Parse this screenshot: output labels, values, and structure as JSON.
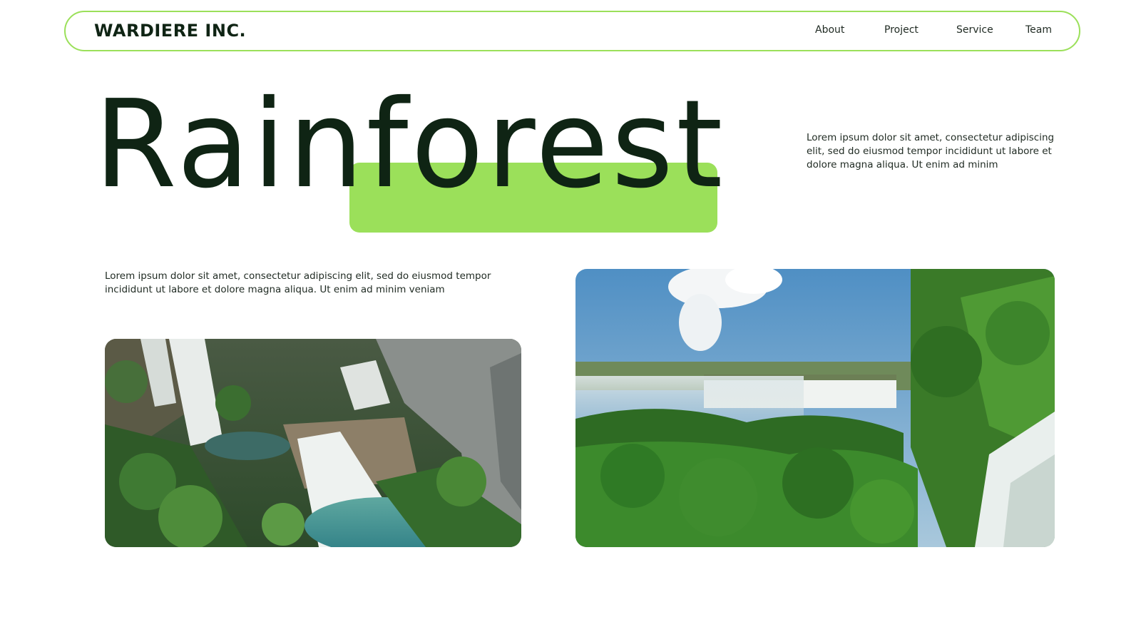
{
  "brand": {
    "name": "WARDIERE INC."
  },
  "nav": {
    "items": [
      {
        "label": "About"
      },
      {
        "label": "Project"
      },
      {
        "label": "Service"
      },
      {
        "label": "Team"
      }
    ]
  },
  "hero": {
    "title": "Rainforest",
    "intro": "Lorem ipsum dolor sit amet, consectetur adipiscing elit, sed do eiusmod tempor incididunt ut labore et dolore magna aliqua. Ut enim ad minim"
  },
  "content": {
    "body": "Lorem ipsum dolor sit amet, consectetur adipiscing elit, sed do eiusmod tempor incididunt ut labore et dolore magna aliqua. Ut enim ad minim veniam"
  },
  "colors": {
    "accent": "#9be05a",
    "text_dark": "#0f2414"
  }
}
